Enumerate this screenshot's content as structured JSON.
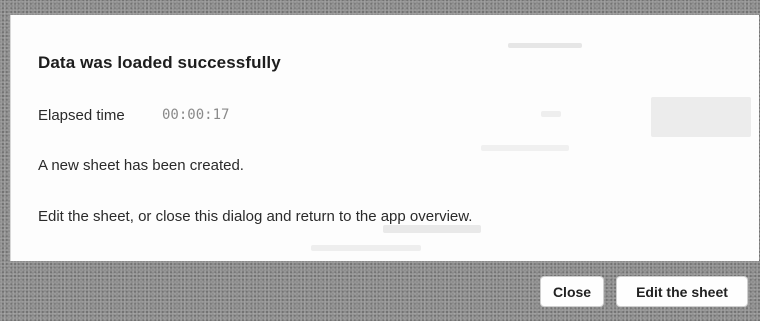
{
  "dialog": {
    "title": "Data was loaded successfully",
    "elapsed_label": "Elapsed time",
    "elapsed_value": "00:00:17",
    "created_message": "A new sheet has been created.",
    "hint_message": "Edit the sheet, or close this dialog and return to the app overview."
  },
  "footer": {
    "close_label": "Close",
    "edit_label": "Edit the sheet"
  },
  "colors": {
    "backdrop": "#8a8a8a",
    "dialog_background": "#fdfdfd",
    "title_text": "#1d1d1d",
    "elapsed_value_text": "#8a8a8a"
  }
}
